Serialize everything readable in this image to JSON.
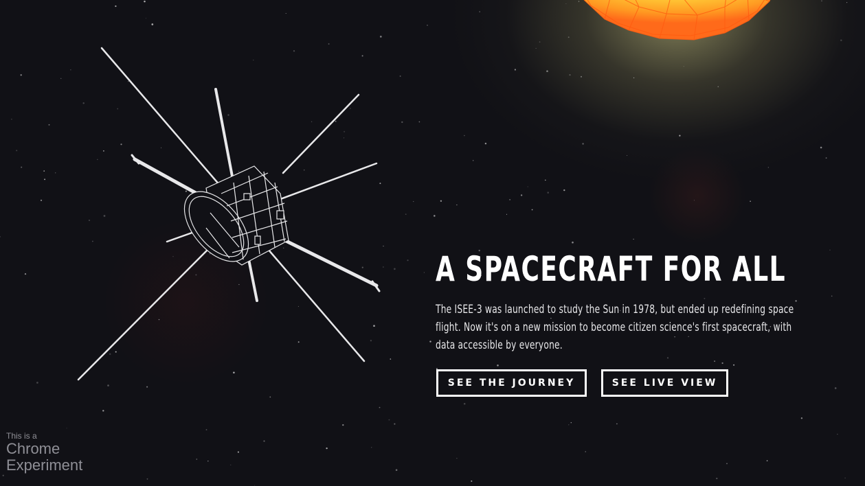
{
  "hero": {
    "title": "A SPACECRAFT FOR ALL",
    "body": "The ISEE-3 was launched to study the Sun in 1978, but ended up redefining space flight. Now it's on a new mission to become citizen science's first spacecraft, with data accessible by everyone."
  },
  "actions": {
    "journey_label": "SEE THE JOURNEY",
    "live_label": "SEE LIVE VIEW"
  },
  "chrome_badge": {
    "prefix": "This is a",
    "line1": "Chrome",
    "line2": "Experiment"
  },
  "colors": {
    "background": "#111116",
    "text": "#ffffff",
    "sun_core": "#ffe95a",
    "sun_edge": "#ff6a1a",
    "badge_text": "#8f8f96"
  },
  "icons": {
    "spacecraft": "isee3-wireframe-icon",
    "sun": "sun-icon"
  }
}
